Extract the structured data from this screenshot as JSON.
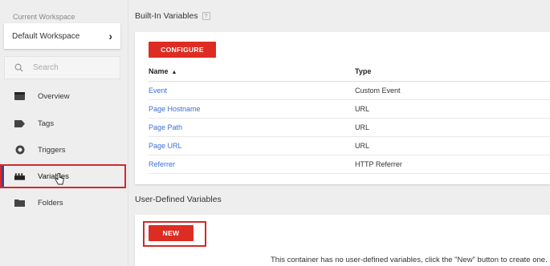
{
  "sidebar": {
    "workspace_label": "Current Workspace",
    "workspace_name": "Default Workspace",
    "search_placeholder": "Search",
    "items": [
      {
        "label": "Overview",
        "icon": "overview-icon"
      },
      {
        "label": "Tags",
        "icon": "tag-icon"
      },
      {
        "label": "Triggers",
        "icon": "trigger-icon"
      },
      {
        "label": "Variables",
        "icon": "variables-icon",
        "active": true
      },
      {
        "label": "Folders",
        "icon": "folder-icon"
      }
    ]
  },
  "builtin": {
    "title": "Built-In Variables",
    "help": "?",
    "configure_label": "CONFIGURE",
    "columns": {
      "name": "Name",
      "type": "Type"
    },
    "rows": [
      {
        "name": "Event",
        "type": "Custom Event"
      },
      {
        "name": "Page Hostname",
        "type": "URL"
      },
      {
        "name": "Page Path",
        "type": "URL"
      },
      {
        "name": "Page URL",
        "type": "URL"
      },
      {
        "name": "Referrer",
        "type": "HTTP Referrer"
      }
    ]
  },
  "user_defined": {
    "title": "User-Defined Variables",
    "new_label": "NEW",
    "empty_message": "This container has no user-defined variables, click the \"New\" button to create one."
  },
  "colors": {
    "accent_red": "#dd2c22",
    "highlight_red": "#d12a2a",
    "link_blue": "#3a6fd8"
  }
}
